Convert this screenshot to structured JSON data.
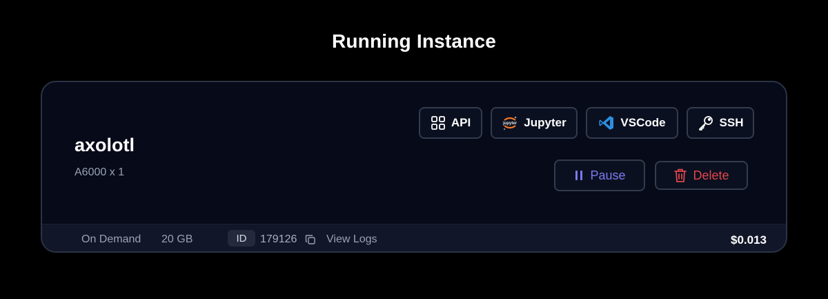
{
  "page": {
    "title": "Running Instance"
  },
  "instance": {
    "name": "axolotl",
    "gpu": "A6000 x 1"
  },
  "actions": {
    "api_label": "API",
    "jupyter_label": "Jupyter",
    "jupyter_logo_text": "jupyter",
    "vscode_label": "VSCode",
    "ssh_label": "SSH",
    "pause_label": "Pause",
    "delete_label": "Delete"
  },
  "footer": {
    "mode": "On Demand",
    "storage": "20 GB",
    "id_badge": "ID",
    "id_value": "179126",
    "logs_label": "View Logs",
    "cost": "$0.013"
  },
  "icons": {
    "api": "grid-icon",
    "jupyter": "jupyter-logo-icon",
    "vscode": "vscode-logo-icon",
    "ssh": "key-icon",
    "pause": "pause-icon",
    "delete": "trash-icon",
    "copy": "copy-icon"
  },
  "colors": {
    "background": "#000000",
    "card": "#060a19",
    "card_border": "#2b3345",
    "footer": "#111728",
    "pause": "#7b79ee",
    "delete": "#e0464a",
    "vscode": "#2b8fe0",
    "jupyter": "#f37726"
  }
}
